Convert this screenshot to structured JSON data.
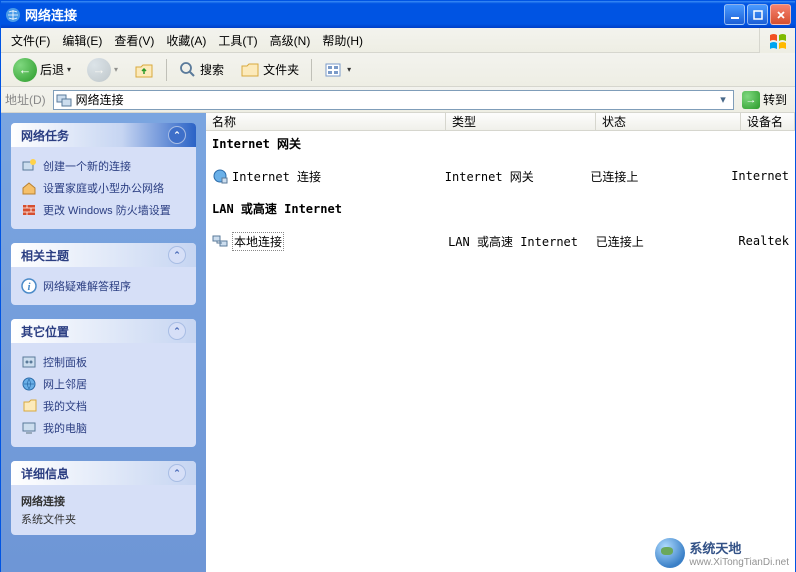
{
  "window": {
    "title": "网络连接"
  },
  "menu": {
    "file": "文件(F)",
    "edit": "编辑(E)",
    "view": "查看(V)",
    "favorites": "收藏(A)",
    "tools": "工具(T)",
    "advanced": "高级(N)",
    "help": "帮助(H)"
  },
  "toolbar": {
    "back": "后退",
    "search": "搜索",
    "folders": "文件夹"
  },
  "address": {
    "label": "地址(D)",
    "value": "网络连接",
    "go": "转到"
  },
  "sidebar": {
    "tasks": {
      "title": "网络任务",
      "items": [
        "创建一个新的连接",
        "设置家庭或小型办公网络",
        "更改 Windows 防火墙设置"
      ]
    },
    "related": {
      "title": "相关主题",
      "items": [
        "网络疑难解答程序"
      ]
    },
    "other": {
      "title": "其它位置",
      "items": [
        "控制面板",
        "网上邻居",
        "我的文档",
        "我的电脑"
      ]
    },
    "details": {
      "title": "详细信息",
      "name": "网络连接",
      "type": "系统文件夹"
    }
  },
  "list": {
    "columns": {
      "name": "名称",
      "type": "类型",
      "status": "状态",
      "device": "设备名"
    },
    "group1": "Internet 网关",
    "group2": "LAN 或高速 Internet",
    "rows": [
      {
        "name": "Internet 连接",
        "type": "Internet 网关",
        "status": "已连接上",
        "device": "Internet"
      },
      {
        "name": "本地连接",
        "type": "LAN 或高速 Internet",
        "status": "已连接上",
        "device": "Realtek"
      }
    ]
  },
  "watermark": {
    "name": "系统天地",
    "url": "www.XiTongTianDi.net"
  }
}
